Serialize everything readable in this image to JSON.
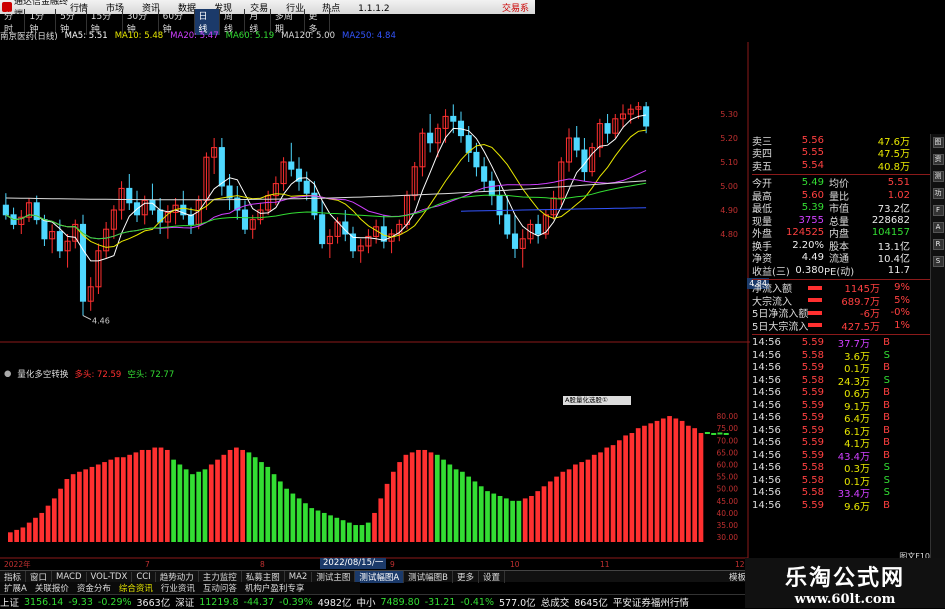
{
  "titlebar": {
    "app": "通达信金融终端",
    "menu": [
      "行情",
      "市场",
      "资讯",
      "数据",
      "发现",
      "交易",
      "行业",
      "热点",
      "1.1.1.2"
    ],
    "account": "交易系"
  },
  "periods": [
    "分时",
    "1分钟",
    "5分钟",
    "15分钟",
    "30分钟",
    "60分钟",
    "日线",
    "周线",
    "月线",
    "多周期",
    "更多"
  ],
  "active_period": "日线",
  "ma_legend": [
    {
      "text": "南京医药(日线)",
      "color": "#dddddd"
    },
    {
      "text": "MA5: 5.51",
      "color": "#ffffff"
    },
    {
      "text": "MA10: 5.48",
      "color": "#e8e800"
    },
    {
      "text": "MA20: 5.47",
      "color": "#d040ff"
    },
    {
      "text": "MA60: 5.19",
      "color": "#33dd33"
    },
    {
      "text": "MA120: 5.00",
      "color": "#dddddd"
    },
    {
      "text": "MA250: 4.84",
      "color": "#3355ff"
    }
  ],
  "chart_data": [
    {
      "type": "candlestick",
      "title": "南京医药(日线)",
      "ylim": [
        4.35,
        5.35
      ],
      "y_ticks": [
        5.3,
        5.2,
        5.1,
        5.0,
        4.9,
        4.8
      ],
      "low_marker": "4.46",
      "last_price_tag": "4.84",
      "ohlc": [
        [
          4.92,
          4.97,
          4.86,
          4.88
        ],
        [
          4.88,
          4.91,
          4.82,
          4.84
        ],
        [
          4.84,
          4.9,
          4.8,
          4.87
        ],
        [
          4.87,
          4.95,
          4.85,
          4.93
        ],
        [
          4.93,
          4.96,
          4.84,
          4.86
        ],
        [
          4.86,
          4.88,
          4.75,
          4.78
        ],
        [
          4.78,
          4.84,
          4.72,
          4.81
        ],
        [
          4.81,
          4.86,
          4.7,
          4.73
        ],
        [
          4.73,
          4.8,
          4.66,
          4.77
        ],
        [
          4.77,
          4.86,
          4.74,
          4.84
        ],
        [
          4.84,
          4.88,
          4.46,
          4.52
        ],
        [
          4.52,
          4.62,
          4.48,
          4.58
        ],
        [
          4.58,
          4.76,
          4.55,
          4.73
        ],
        [
          4.73,
          4.85,
          4.7,
          4.82
        ],
        [
          4.82,
          4.92,
          4.78,
          4.9
        ],
        [
          4.9,
          5.02,
          4.86,
          4.99
        ],
        [
          4.99,
          5.05,
          4.9,
          4.93
        ],
        [
          4.93,
          4.98,
          4.85,
          4.88
        ],
        [
          4.88,
          4.96,
          4.84,
          4.94
        ],
        [
          4.94,
          5.01,
          4.88,
          4.9
        ],
        [
          4.9,
          4.95,
          4.8,
          4.85
        ],
        [
          4.85,
          4.92,
          4.78,
          4.89
        ],
        [
          4.89,
          4.95,
          4.84,
          4.92
        ],
        [
          4.92,
          4.98,
          4.86,
          4.88
        ],
        [
          4.88,
          4.91,
          4.8,
          4.84
        ],
        [
          4.84,
          4.96,
          4.82,
          4.94
        ],
        [
          4.94,
          5.14,
          4.9,
          5.12
        ],
        [
          5.12,
          5.2,
          5.05,
          5.16
        ],
        [
          5.16,
          5.2,
          4.96,
          5.0
        ],
        [
          5.0,
          5.05,
          4.9,
          4.95
        ],
        [
          4.95,
          5.0,
          4.86,
          4.9
        ],
        [
          4.9,
          4.94,
          4.8,
          4.82
        ],
        [
          4.82,
          4.88,
          4.78,
          4.86
        ],
        [
          4.86,
          4.93,
          4.84,
          4.9
        ],
        [
          4.9,
          4.98,
          4.88,
          4.96
        ],
        [
          4.96,
          5.04,
          4.92,
          5.01
        ],
        [
          5.01,
          5.12,
          4.98,
          5.1
        ],
        [
          5.1,
          5.18,
          5.04,
          5.07
        ],
        [
          5.07,
          5.12,
          4.98,
          5.02
        ],
        [
          5.02,
          5.06,
          4.94,
          4.97
        ],
        [
          4.97,
          5.02,
          4.86,
          4.88
        ],
        [
          4.88,
          4.94,
          4.74,
          4.76
        ],
        [
          4.76,
          4.82,
          4.7,
          4.79
        ],
        [
          4.79,
          4.87,
          4.76,
          4.85
        ],
        [
          4.85,
          4.9,
          4.77,
          4.8
        ],
        [
          4.8,
          4.83,
          4.7,
          4.73
        ],
        [
          4.73,
          4.78,
          4.68,
          4.75
        ],
        [
          4.75,
          4.82,
          4.72,
          4.79
        ],
        [
          4.79,
          4.86,
          4.76,
          4.83
        ],
        [
          4.83,
          4.88,
          4.74,
          4.77
        ],
        [
          4.77,
          4.82,
          4.72,
          4.8
        ],
        [
          4.8,
          4.86,
          4.77,
          4.84
        ],
        [
          4.84,
          4.98,
          4.82,
          4.96
        ],
        [
          4.96,
          5.1,
          4.94,
          5.08
        ],
        [
          5.08,
          5.24,
          5.04,
          5.22
        ],
        [
          5.22,
          5.3,
          5.14,
          5.18
        ],
        [
          5.18,
          5.26,
          5.12,
          5.24
        ],
        [
          5.24,
          5.32,
          5.18,
          5.29
        ],
        [
          5.29,
          5.34,
          5.22,
          5.27
        ],
        [
          5.27,
          5.31,
          5.18,
          5.21
        ],
        [
          5.21,
          5.25,
          5.1,
          5.14
        ],
        [
          5.14,
          5.18,
          5.04,
          5.08
        ],
        [
          5.08,
          5.12,
          4.98,
          5.02
        ],
        [
          5.02,
          5.06,
          4.92,
          4.96
        ],
        [
          4.96,
          5.0,
          4.84,
          4.88
        ],
        [
          4.88,
          4.96,
          4.78,
          4.8
        ],
        [
          4.8,
          4.88,
          4.7,
          4.74
        ],
        [
          4.74,
          4.82,
          4.66,
          4.78
        ],
        [
          4.78,
          4.86,
          4.76,
          4.84
        ],
        [
          4.84,
          4.88,
          4.76,
          4.8
        ],
        [
          4.8,
          4.9,
          4.78,
          4.88
        ],
        [
          4.88,
          4.98,
          4.86,
          4.95
        ],
        [
          4.95,
          5.12,
          4.92,
          5.1
        ],
        [
          5.1,
          5.24,
          5.06,
          5.2
        ],
        [
          5.2,
          5.25,
          5.12,
          5.15
        ],
        [
          5.15,
          5.2,
          5.02,
          5.06
        ],
        [
          5.06,
          5.18,
          5.04,
          5.16
        ],
        [
          5.16,
          5.28,
          5.12,
          5.26
        ],
        [
          5.26,
          5.3,
          5.18,
          5.22
        ],
        [
          5.22,
          5.3,
          5.2,
          5.28
        ],
        [
          5.28,
          5.34,
          5.24,
          5.3
        ],
        [
          5.3,
          5.34,
          5.26,
          5.32
        ],
        [
          5.32,
          5.35,
          5.28,
          5.33
        ],
        [
          5.33,
          5.35,
          5.22,
          5.25
        ]
      ],
      "ma_colors": {
        "ma5": "#ffffff",
        "ma10": "#e8e800",
        "ma20": "#d040ff",
        "ma60": "#33dd33",
        "ma120": "#dddddd",
        "ma250": "#3355ff"
      }
    },
    {
      "type": "bar",
      "title": "量化多空转换",
      "legend": [
        {
          "name": "多头: 72.59",
          "color": "#ff3030"
        },
        {
          "name": "空头: 72.77",
          "color": "#33dd33"
        }
      ],
      "ylim": [
        28,
        92
      ],
      "y_ticks": [
        80.0,
        75.0,
        70.0,
        65.0,
        60.0,
        55.0,
        50.0,
        45.0,
        40.0,
        35.0,
        30.0
      ],
      "x_labels": [
        "2022年",
        "7",
        "8",
        "2022/08/15/一",
        "9",
        "10",
        "11",
        "12"
      ],
      "tooltip": "A股量化选股①",
      "values": [
        32,
        33,
        34,
        36,
        38,
        40,
        43,
        46,
        50,
        54,
        56,
        57,
        58,
        59,
        60,
        61,
        62,
        63,
        63,
        64,
        65,
        66,
        66,
        67,
        67,
        66,
        62,
        60,
        58,
        56,
        57,
        58,
        60,
        62,
        64,
        66,
        67,
        66,
        65,
        63,
        61,
        59,
        56,
        53,
        50,
        48,
        46,
        44,
        42,
        41,
        40,
        39,
        38,
        37,
        36,
        35,
        35,
        36,
        40,
        46,
        52,
        57,
        61,
        64,
        65,
        66,
        66,
        65,
        64,
        62,
        60,
        58,
        57,
        55,
        53,
        51,
        49,
        48,
        47,
        46,
        45,
        45,
        46,
        47,
        49,
        51,
        53,
        55,
        57,
        58,
        60,
        61,
        62,
        64,
        65,
        67,
        68,
        70,
        72,
        73,
        75,
        76,
        77,
        78,
        79,
        80,
        79,
        78,
        76,
        75,
        73,
        73,
        72.6,
        72.8,
        72.6
      ],
      "bar_colors": [
        "r",
        "r",
        "r",
        "r",
        "r",
        "r",
        "r",
        "r",
        "r",
        "r",
        "r",
        "r",
        "r",
        "r",
        "r",
        "r",
        "r",
        "r",
        "r",
        "r",
        "r",
        "r",
        "r",
        "r",
        "r",
        "r",
        "g",
        "g",
        "g",
        "g",
        "g",
        "g",
        "r",
        "r",
        "r",
        "r",
        "r",
        "r",
        "g",
        "g",
        "g",
        "g",
        "g",
        "g",
        "g",
        "g",
        "g",
        "g",
        "g",
        "g",
        "g",
        "g",
        "g",
        "g",
        "g",
        "g",
        "g",
        "g",
        "r",
        "r",
        "r",
        "r",
        "r",
        "r",
        "r",
        "r",
        "r",
        "r",
        "g",
        "g",
        "g",
        "g",
        "g",
        "g",
        "g",
        "g",
        "g",
        "g",
        "g",
        "g",
        "g",
        "g",
        "r",
        "r",
        "r",
        "r",
        "r",
        "r",
        "r",
        "r",
        "r",
        "r",
        "r",
        "r",
        "r",
        "r",
        "r",
        "r",
        "r",
        "r",
        "r",
        "r",
        "r",
        "r",
        "r",
        "r",
        "r",
        "r",
        "r",
        "r",
        "r",
        "g",
        "g",
        "g",
        "g"
      ]
    }
  ],
  "quotes": {
    "asks": [
      {
        "label": "卖三",
        "price": "5.56",
        "vol": "47.6万"
      },
      {
        "label": "卖四",
        "price": "5.55",
        "vol": "47.5万"
      },
      {
        "label": "卖五",
        "price": "5.54",
        "vol": "40.8万"
      }
    ],
    "rows": [
      {
        "a": "今开",
        "b": "5.49",
        "bc": "green",
        "c": "均价",
        "d": "5.51",
        "dc": "red"
      },
      {
        "a": "最高",
        "b": "5.60",
        "bc": "red",
        "c": "量比",
        "d": "1.02",
        "dc": "red"
      },
      {
        "a": "最低",
        "b": "5.39",
        "bc": "green",
        "c": "市值",
        "d": "73.2亿",
        "dc": "white"
      },
      {
        "a": "现量",
        "b": "3755",
        "bc": "purple",
        "c": "总量",
        "d": "228682",
        "dc": "white"
      },
      {
        "a": "外盘",
        "b": "124525",
        "bc": "red",
        "c": "内盘",
        "d": "104157",
        "dc": "green"
      },
      {
        "a": "换手",
        "b": "2.20%",
        "bc": "white",
        "c": "股本",
        "d": "13.1亿",
        "dc": "white"
      },
      {
        "a": "净资",
        "b": "4.49",
        "bc": "white",
        "c": "流通",
        "d": "10.4亿",
        "dc": "white"
      },
      {
        "a": "收益(三)",
        "b": "0.380",
        "bc": "white",
        "c": "PE(动)",
        "d": "11.7",
        "dc": "white"
      }
    ],
    "flows": [
      {
        "label": "净流入额",
        "value": "1145万",
        "pct": "9%"
      },
      {
        "label": "大宗流入",
        "value": "689.7万",
        "pct": "5%"
      },
      {
        "label": "5日净流入额",
        "value": "-6万",
        "pct": "-0%"
      },
      {
        "label": "5日大宗流入",
        "value": "427.5万",
        "pct": "1%"
      }
    ],
    "ticks": [
      {
        "t": "14:56",
        "p": "5.59",
        "v": "37.7万",
        "vc": "purple",
        "s": "B"
      },
      {
        "t": "14:56",
        "p": "5.58",
        "v": "3.6万",
        "vc": "yellow",
        "s": "S"
      },
      {
        "t": "14:56",
        "p": "5.59",
        "v": "0.1万",
        "vc": "yellow",
        "s": "B"
      },
      {
        "t": "14:56",
        "p": "5.58",
        "v": "24.3万",
        "vc": "yellow",
        "s": "S"
      },
      {
        "t": "14:56",
        "p": "5.59",
        "v": "0.6万",
        "vc": "yellow",
        "s": "B"
      },
      {
        "t": "14:56",
        "p": "5.59",
        "v": "9.1万",
        "vc": "yellow",
        "s": "B"
      },
      {
        "t": "14:56",
        "p": "5.59",
        "v": "6.4万",
        "vc": "yellow",
        "s": "B"
      },
      {
        "t": "14:56",
        "p": "5.59",
        "v": "6.1万",
        "vc": "yellow",
        "s": "B"
      },
      {
        "t": "14:56",
        "p": "5.59",
        "v": "4.1万",
        "vc": "yellow",
        "s": "B"
      },
      {
        "t": "14:56",
        "p": "5.59",
        "v": "43.4万",
        "vc": "purple",
        "s": "B"
      },
      {
        "t": "14:56",
        "p": "5.58",
        "v": "0.3万",
        "vc": "yellow",
        "s": "S"
      },
      {
        "t": "14:56",
        "p": "5.58",
        "v": "0.1万",
        "vc": "yellow",
        "s": "S"
      },
      {
        "t": "14:56",
        "p": "5.58",
        "v": "33.4万",
        "vc": "purple",
        "s": "S"
      },
      {
        "t": "14:56",
        "p": "5.59",
        "v": "9.6万",
        "vc": "yellow",
        "s": "B"
      }
    ]
  },
  "rightstrip": [
    "图",
    "资",
    "测",
    "功",
    "F",
    "A",
    "R",
    "S"
  ],
  "tabs": [
    "指标",
    "窗口",
    "MACD",
    "VOL-TDX",
    "CCI",
    "趋势动力",
    "主力监控",
    "私募主图",
    "MA2",
    "测试主图",
    "测试幅图A",
    "测试幅图B",
    "更多",
    "设置"
  ],
  "active_tab": "测试幅图A",
  "tab_extra": "模板",
  "subtabs": [
    {
      "text": "扩展A",
      "hl": false
    },
    {
      "text": "关联报价",
      "hl": false
    },
    {
      "text": "资金分布",
      "hl": false
    },
    {
      "text": "综合资讯",
      "hl": true
    },
    {
      "text": "行业资讯",
      "hl": false
    },
    {
      "text": "互动问答",
      "hl": false
    },
    {
      "text": "机构户盈利专享",
      "hl": false
    }
  ],
  "status": [
    {
      "text": "上证",
      "c": "white"
    },
    {
      "text": "3156.14",
      "c": "green"
    },
    {
      "text": "-9.33",
      "c": "green"
    },
    {
      "text": "-0.29%",
      "c": "green"
    },
    {
      "text": "3663亿",
      "c": "white"
    },
    {
      "text": "深证",
      "c": "white"
    },
    {
      "text": "11219.8",
      "c": "green"
    },
    {
      "text": "-44.37",
      "c": "green"
    },
    {
      "text": "-0.39%",
      "c": "green"
    },
    {
      "text": "4982亿",
      "c": "white"
    },
    {
      "text": "中小",
      "c": "white"
    },
    {
      "text": "7489.80",
      "c": "green"
    },
    {
      "text": "-31.21",
      "c": "green"
    },
    {
      "text": "-0.41%",
      "c": "green"
    },
    {
      "text": "577.0亿",
      "c": "white"
    },
    {
      "text": "总成交",
      "c": "white"
    },
    {
      "text": "8645亿",
      "c": "white"
    },
    {
      "text": "平安证券福州行情",
      "c": "white"
    }
  ],
  "watermark": {
    "line1": "乐淘公式网",
    "line2": "www.60lt.com"
  },
  "side_header": "图文F10"
}
